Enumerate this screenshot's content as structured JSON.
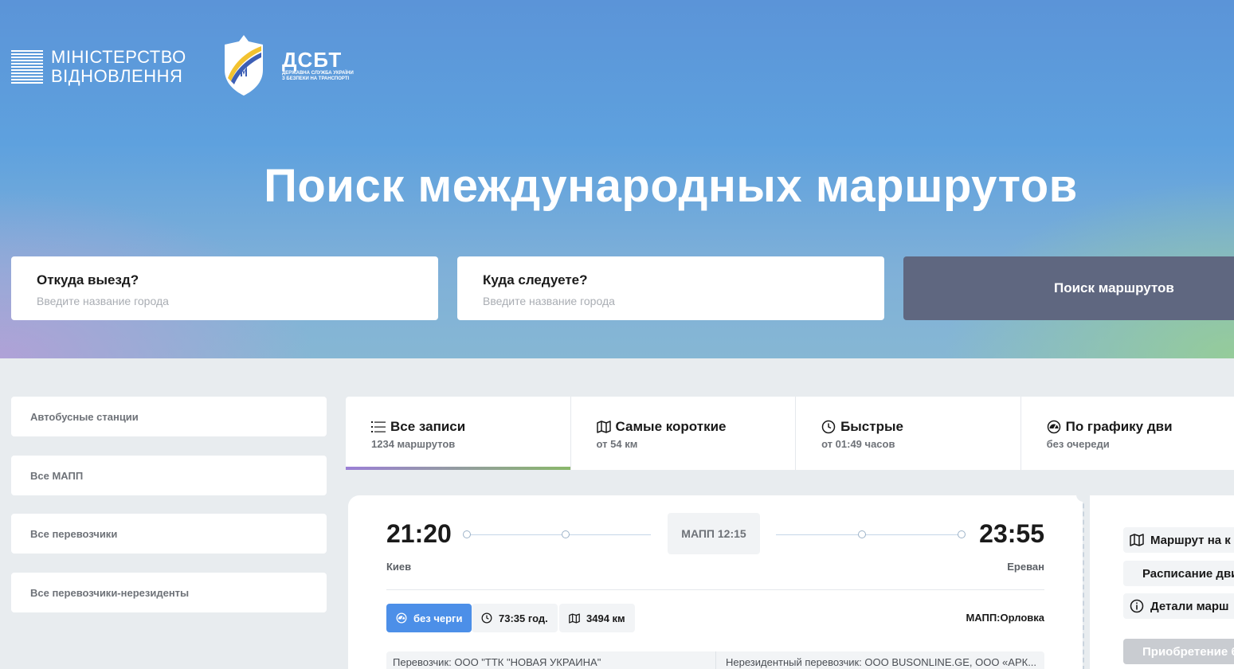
{
  "header": {
    "ministry_logo_text": [
      "МІНІСТЕРСТВО",
      "ВІДНОВЛЕННЯ"
    ],
    "dsbt_logo_title": "ДСБТ",
    "dsbt_logo_subtitle": [
      "ДЕРЖАВНА СЛУЖБА УКРАЇНИ",
      "З БЕЗПЕКИ НА ТРАНСПОРТІ"
    ]
  },
  "hero": {
    "title": "Поиск международных маршрутов"
  },
  "search": {
    "from_label": "Откуда выезд?",
    "from_placeholder": "Введите название города",
    "to_label": "Куда следуете?",
    "to_placeholder": "Введите название города",
    "button_label": "Поиск маршрутов"
  },
  "sidebar": {
    "items": [
      {
        "label": "Автобусные станции"
      },
      {
        "label": "Все МАПП"
      },
      {
        "label": "Все перевозчики"
      },
      {
        "label": "Все перевозчики-нерезиденты"
      }
    ]
  },
  "tabs": [
    {
      "label": "Все записи",
      "sub": "1234 маршрутов",
      "icon": "list-icon"
    },
    {
      "label": "Самые короткие",
      "sub": "от 54 км",
      "icon": "map-icon"
    },
    {
      "label": "Быстрые",
      "sub": "от 01:49 часов",
      "icon": "clock-icon"
    },
    {
      "label": "По графику дви",
      "sub": "без очереди",
      "icon": "gauge-icon"
    }
  ],
  "route": {
    "depart_time": "21:20",
    "depart_city": "Киев",
    "mapp_label": "МАПП 12:15",
    "arrive_time": "23:55",
    "arrive_city": "Ереван",
    "chips": {
      "queue": "без черги",
      "duration": "73:35 год.",
      "distance": "3494 км"
    },
    "mapp_location": "МАПП:Орловка",
    "carrier": "Перевозчик: ООО \"ТТК \"НОВАЯ УКРАИНА\"",
    "nonresident_carrier": "Нерезидентный перевозчик: ООО BUSONLINE.GE, ООО «АРК..."
  },
  "side_actions": {
    "map": "Маршрут на к",
    "schedule": "Расписание дви",
    "details": "Детали марш",
    "buy": "Приобретение б"
  },
  "colors": {
    "search_button": "#5f6780",
    "primary_chip": "#4c8fe8",
    "page_bg": "#e8ecef"
  }
}
